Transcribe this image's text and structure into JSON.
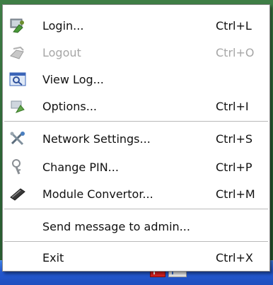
{
  "menu": {
    "items": [
      {
        "label": "Login...",
        "shortcut": "Ctrl+L",
        "icon": "login-icon",
        "enabled": true
      },
      {
        "label": "Logout",
        "shortcut": "Ctrl+O",
        "icon": "logout-icon",
        "enabled": false
      },
      {
        "label": "View Log...",
        "shortcut": "",
        "icon": "view-log-icon",
        "enabled": true
      },
      {
        "label": "Options...",
        "shortcut": "Ctrl+I",
        "icon": "options-icon",
        "enabled": true
      },
      {
        "label": "Network Settings...",
        "shortcut": "Ctrl+S",
        "icon": "network-settings-icon",
        "enabled": true
      },
      {
        "label": "Change PIN...",
        "shortcut": "Ctrl+P",
        "icon": "change-pin-icon",
        "enabled": true
      },
      {
        "label": "Module Convertor...",
        "shortcut": "Ctrl+M",
        "icon": "module-convertor-icon",
        "enabled": true
      },
      {
        "label": "Send message to admin...",
        "shortcut": "",
        "icon": "",
        "enabled": true
      },
      {
        "label": "Exit",
        "shortcut": "Ctrl+X",
        "icon": "",
        "enabled": true
      }
    ]
  },
  "colors": {
    "menu_background": "#ffffff",
    "disabled_text": "#a6a6a6",
    "taskbar": "#2458cf"
  }
}
